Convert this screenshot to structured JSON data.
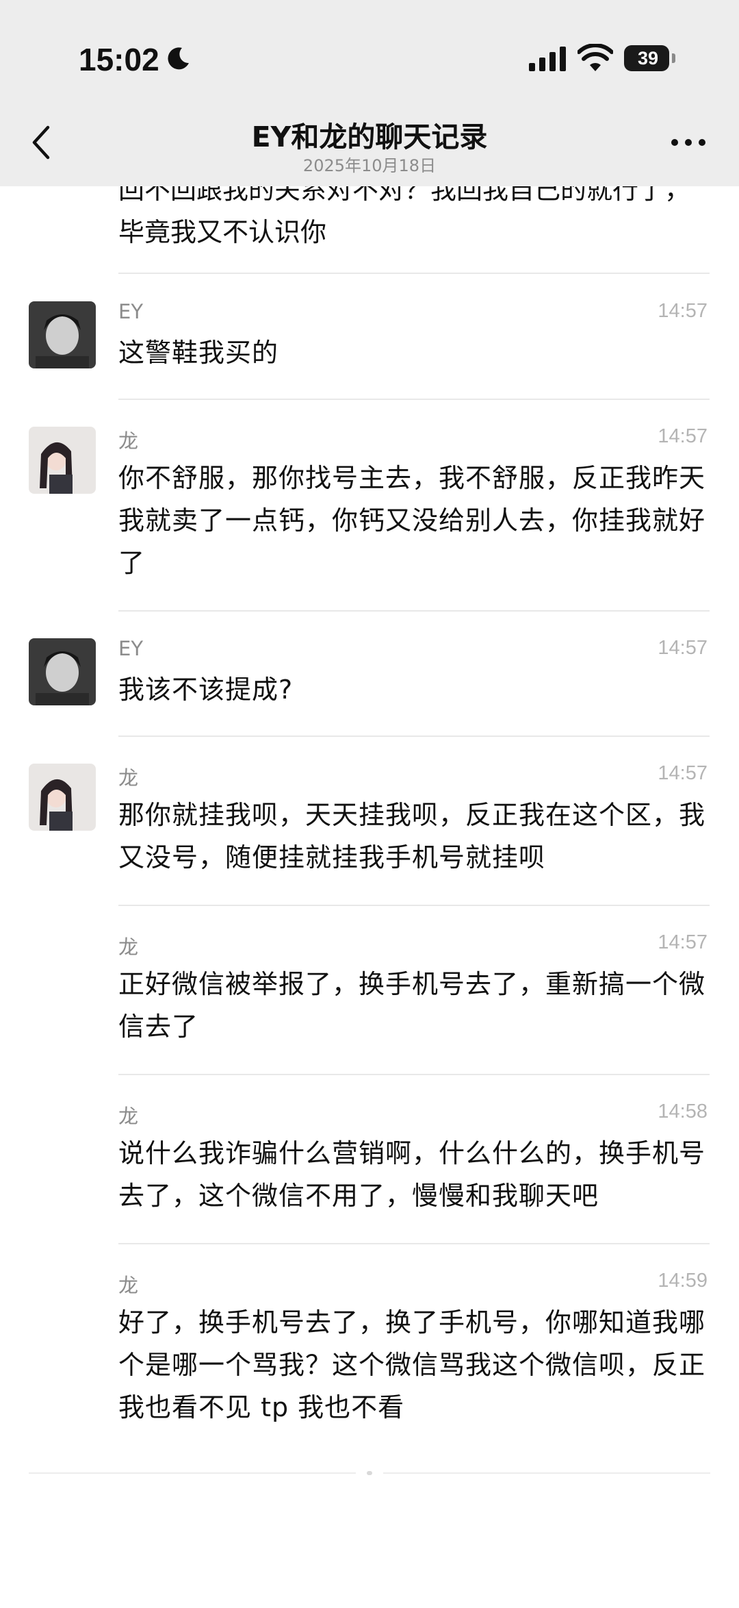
{
  "status_bar": {
    "time": "15:02",
    "battery": "39"
  },
  "header": {
    "title": "EY和龙的聊天记录",
    "subtitle": "2025年10月18日"
  },
  "partial_message": "回不回跟我的关系对不对？我回我自己的就行了，毕竟我又不认识你",
  "messages": [
    {
      "sender": "EY",
      "time": "14:57",
      "text": "这警鞋我买的"
    },
    {
      "sender": "龙",
      "time": "14:57",
      "text": "你不舒服，那你找号主去，我不舒服，反正我昨天我就卖了一点钙，你钙又没给别人去，你挂我就好了"
    },
    {
      "sender": "EY",
      "time": "14:57",
      "text": "我该不该提成?"
    },
    {
      "sender": "龙",
      "time": "14:57",
      "text": "那你就挂我呗，天天挂我呗，反正我在这个区，我又没号，随便挂就挂我手机号就挂呗"
    },
    {
      "sender": "龙",
      "time": "14:57",
      "text": "正好微信被举报了，换手机号去了，重新搞一个微信去了"
    },
    {
      "sender": "龙",
      "time": "14:58",
      "text": "说什么我诈骗什么营销啊，什么什么的，换手机号去了，这个微信不用了，慢慢和我聊天吧"
    },
    {
      "sender": "龙",
      "time": "14:59",
      "text": "好了，换手机号去了，换了手机号，你哪知道我哪个是哪一个骂我？这个微信骂我这个微信呗，反正我也看不见 tp 我也不看"
    }
  ]
}
